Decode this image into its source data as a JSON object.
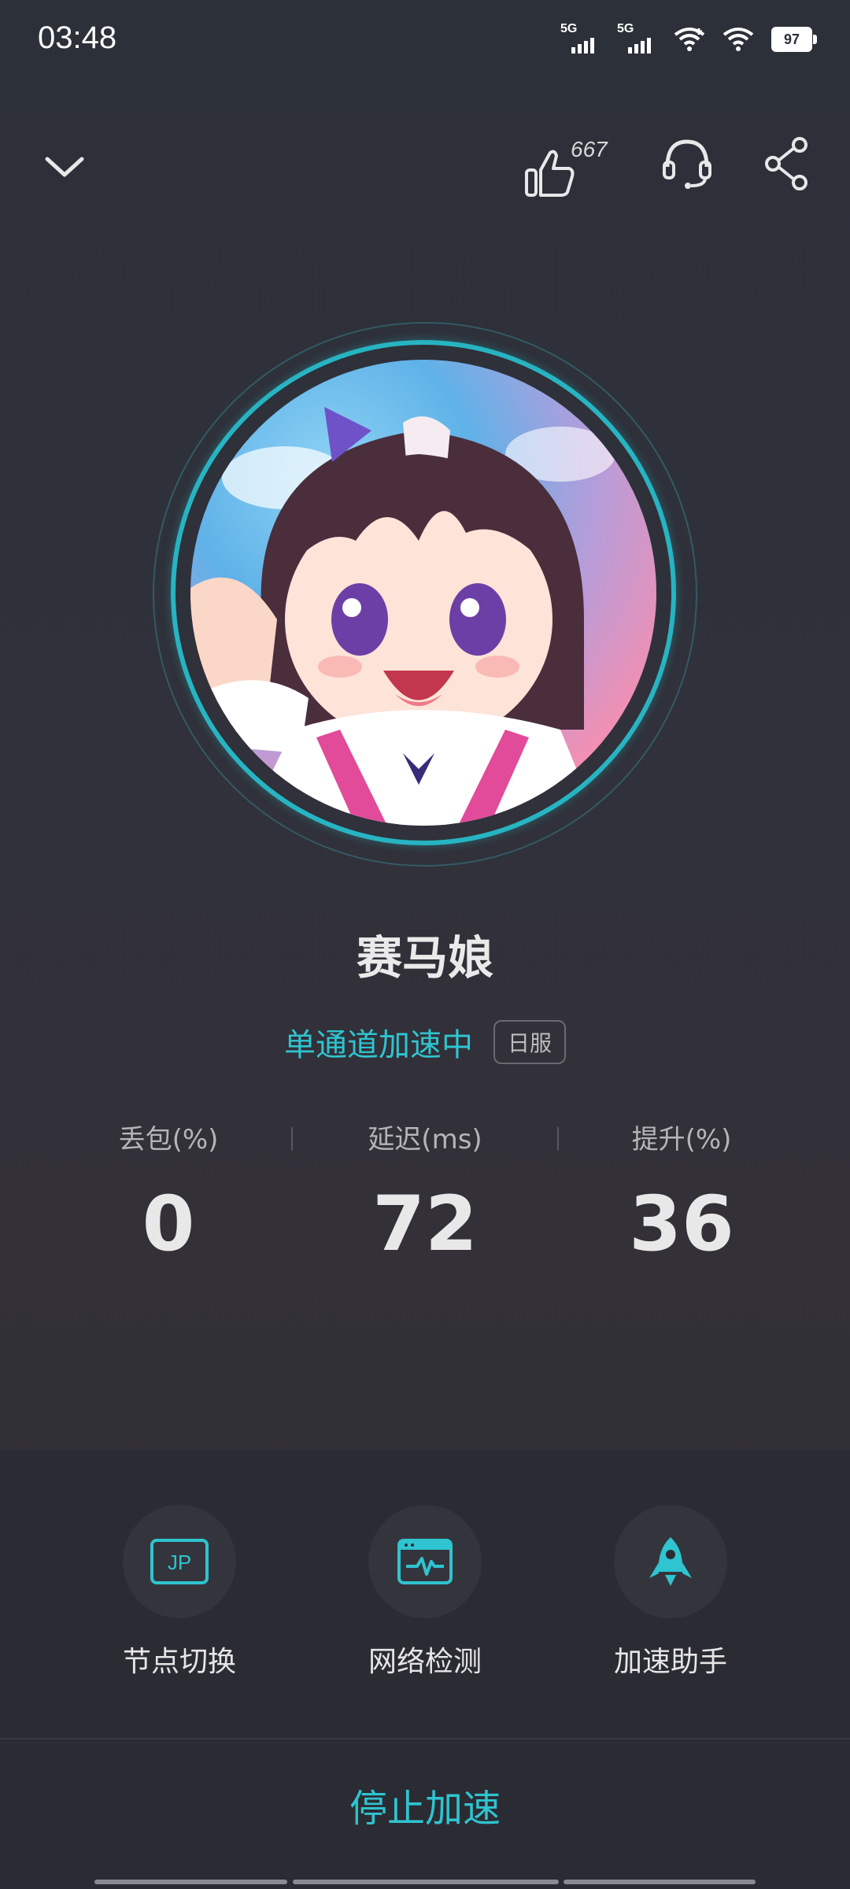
{
  "status_bar": {
    "time": "03:48",
    "signal1_label": "5G",
    "signal2_label": "5G",
    "battery": "97"
  },
  "header": {
    "like_count": "667"
  },
  "game": {
    "title": "赛马娘",
    "accel_status": "单通道加速中",
    "region": "日服"
  },
  "stats": [
    {
      "label": "丢包(%)",
      "value": "0"
    },
    {
      "label": "延迟(ms)",
      "value": "72"
    },
    {
      "label": "提升(%)",
      "value": "36"
    }
  ],
  "tools": [
    {
      "label": "节点切换",
      "icon_text": "JP",
      "icon": "jp-node-icon"
    },
    {
      "label": "网络检测",
      "icon": "network-monitor-icon"
    },
    {
      "label": "加速助手",
      "icon": "rocket-icon"
    }
  ],
  "stop_label": "停止加速",
  "colors": {
    "accent": "#2ec4d0",
    "background": "#2e3038",
    "panel": "#2b2c33"
  }
}
